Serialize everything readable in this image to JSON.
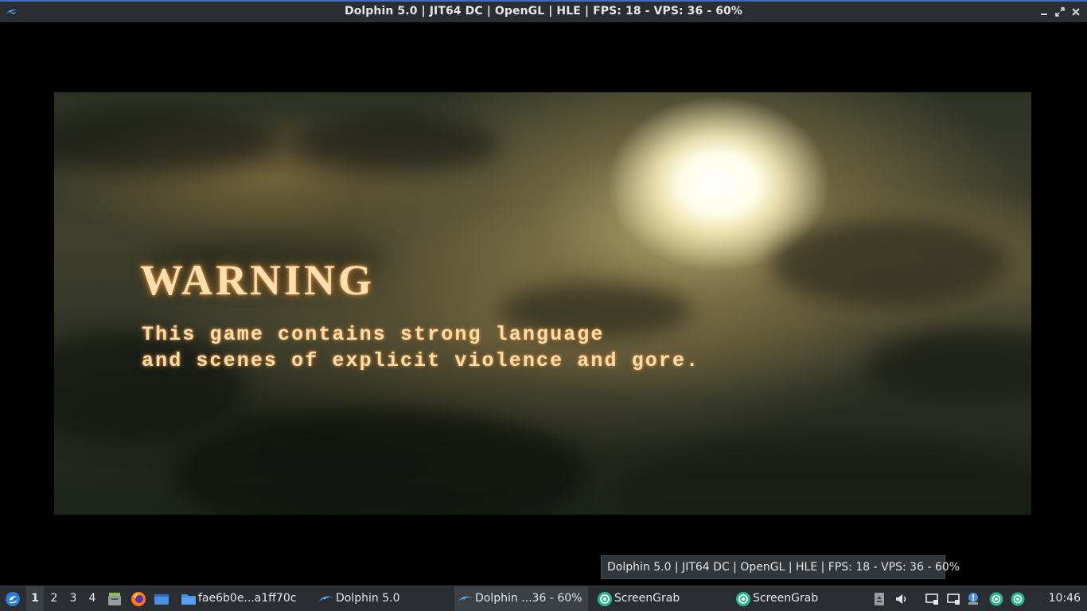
{
  "window": {
    "title": "Dolphin 5.0 | JIT64 DC | OpenGL | HLE | FPS: 18 - VPS: 36 - 60%",
    "controls": [
      "minimize",
      "maximize",
      "close"
    ]
  },
  "game_screen": {
    "heading": "WARNING",
    "line1": "This game contains strong language",
    "line2": "and scenes of explicit violence and gore."
  },
  "tooltip": {
    "text": "Dolphin 5.0 | JIT64 DC | OpenGL | HLE | FPS: 18 - VPS: 36 - 60%"
  },
  "taskbar": {
    "pager": [
      "1",
      "2",
      "3",
      "4"
    ],
    "active_desktop": "1",
    "tasks": [
      {
        "label": "fae6b0e...a1ff70c",
        "icon": "folder-icon"
      },
      {
        "label": "Dolphin 5.0",
        "icon": "dolphin-icon"
      },
      {
        "label": "Dolphin ...36 - 60%",
        "icon": "dolphin-icon",
        "active": true
      },
      {
        "label": "ScreenGrab",
        "icon": "screengrab-icon"
      },
      {
        "label": "ScreenGrab",
        "icon": "screengrab-icon"
      }
    ],
    "clock": "10:46"
  },
  "colors": {
    "accent": "#3d6fbf",
    "panel": "#2a2e32",
    "warning_text": "#ffdfae"
  }
}
